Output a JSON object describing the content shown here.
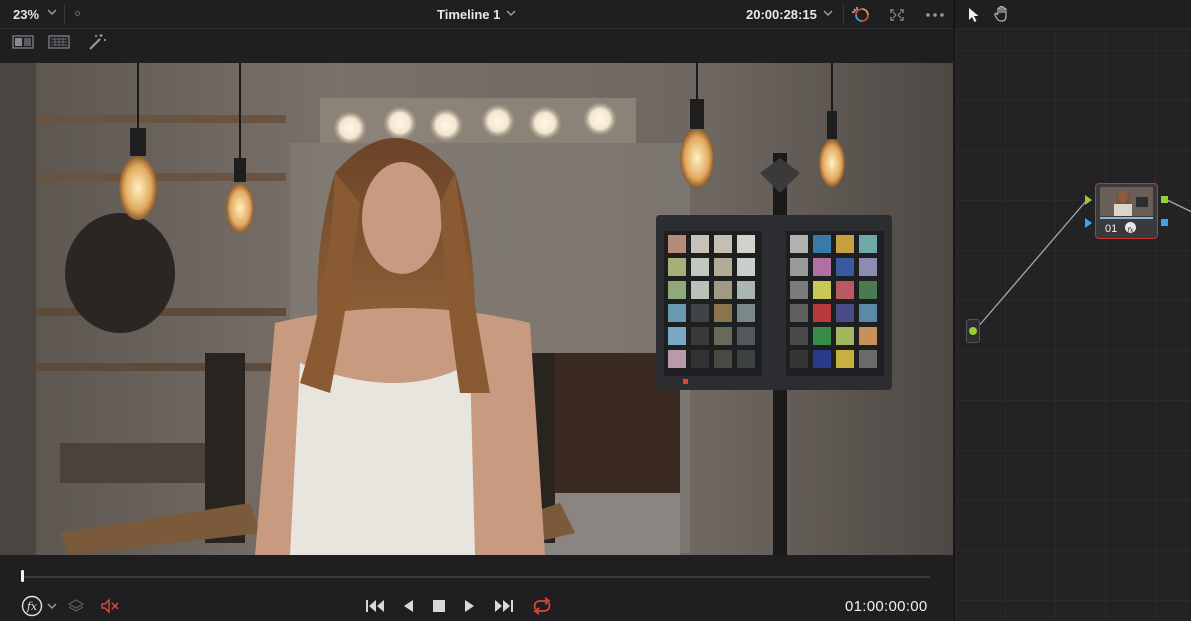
{
  "viewer": {
    "zoom_label": "23%",
    "timeline_title": "Timeline 1",
    "source_timecode": "20:00:28:15",
    "record_timecode": "01:00:00:00",
    "playhead_fraction": 0.0
  },
  "icons": {
    "zoom_dropdown": "chevron-down-icon",
    "title_dropdown": "chevron-down-icon",
    "timecode_dropdown": "chevron-down-icon",
    "highlight": "highlight-wand-icon",
    "fullscreen": "fullscreen-icon",
    "more": "more-options-icon",
    "pointer": "pointer-tool-icon",
    "hand": "hand-tool-icon",
    "split_wipe": "split-wipe-icon",
    "gallery_grid": "gallery-grid-icon",
    "magic_mask": "magic-wand-icon",
    "fx": "fx-icon",
    "layers": "layers-icon",
    "mute": "mute-icon",
    "skip_back": "skip-to-start-icon",
    "step_back": "play-reverse-icon",
    "stop": "stop-icon",
    "play": "play-icon",
    "skip_forward": "skip-to-end-icon",
    "loop": "loop-icon"
  },
  "colors": {
    "accent_red": "#e0453d",
    "node_border": "#c8342f",
    "input_green": "#9acd32",
    "output_blue": "#3aa6e8"
  },
  "node_graph": {
    "node_label": "01"
  }
}
